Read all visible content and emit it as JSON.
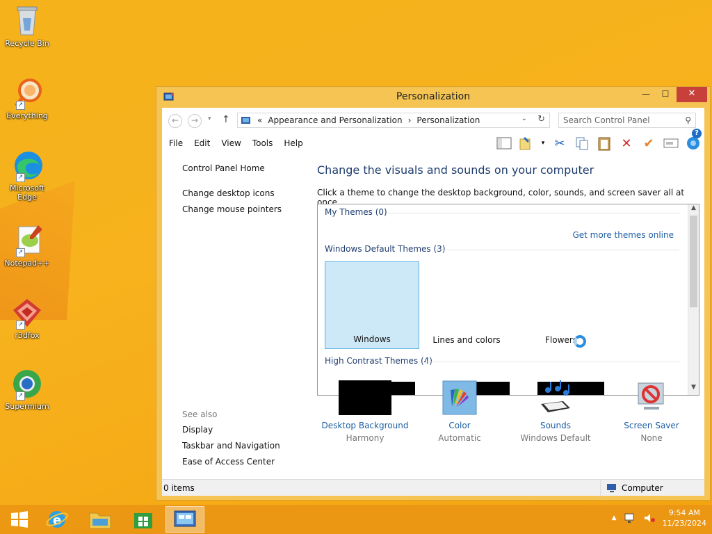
{
  "desktop": {
    "icons": [
      {
        "label": "Recycle Bin"
      },
      {
        "label": "Everything"
      },
      {
        "label": "Microsoft Edge"
      },
      {
        "label": "Notepad++"
      },
      {
        "label": "r3dfox"
      },
      {
        "label": "Supermium"
      }
    ]
  },
  "window": {
    "title": "Personalization",
    "controls": {
      "minimize": "—",
      "maximize": "☐",
      "close": "✕"
    }
  },
  "address": {
    "prefix": "«",
    "crumbs": [
      "Appearance and Personalization",
      "Personalization"
    ],
    "separator": "›",
    "search_placeholder": "Search Control Panel"
  },
  "menu": [
    "File",
    "Edit",
    "View",
    "Tools",
    "Help"
  ],
  "left_pane": {
    "home": "Control Panel Home",
    "links": [
      "Change desktop icons",
      "Change mouse pointers"
    ],
    "see_also_label": "See also",
    "see_also": [
      "Display",
      "Taskbar and Navigation",
      "Ease of Access Center"
    ]
  },
  "content": {
    "heading": "Change the visuals and sounds on your computer",
    "subheading": "Click a theme to change the desktop background, color, sounds, and screen saver all at once.",
    "my_themes": "My Themes (0)",
    "get_more": "Get more themes online",
    "default_themes": "Windows Default Themes (3)",
    "themes": [
      {
        "label": "Windows",
        "selected": true
      },
      {
        "label": "Lines and colors",
        "selected": false
      },
      {
        "label": "Flowers",
        "selected": false
      }
    ],
    "high_contrast": "High Contrast Themes (4)"
  },
  "personalize": [
    {
      "link": "Desktop Background",
      "value": "Harmony",
      "icon": "desktop-background-icon"
    },
    {
      "link": "Color",
      "value": "Automatic",
      "icon": "color-icon"
    },
    {
      "link": "Sounds",
      "value": "Windows Default",
      "icon": "sounds-icon"
    },
    {
      "link": "Screen Saver",
      "value": "None",
      "icon": "screen-saver-icon"
    }
  ],
  "status": {
    "items": "0 items",
    "location": "Computer"
  },
  "taskbar": {
    "time": "9:54 AM",
    "date": "11/23/2024"
  },
  "colors": {
    "accent": "#f5b21a",
    "link": "#1f5fa4",
    "selected_tile": "#cde8f7"
  }
}
